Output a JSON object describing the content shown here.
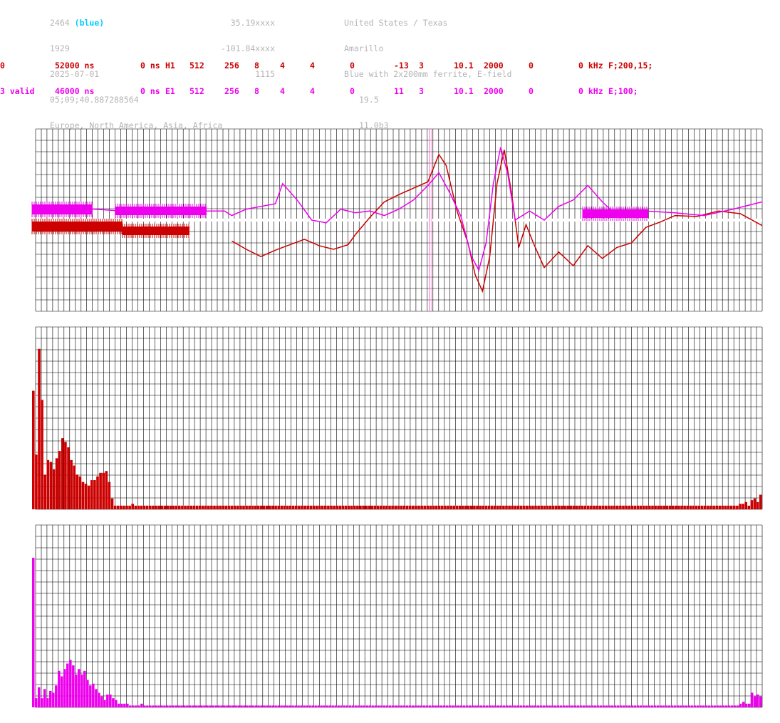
{
  "header": {
    "id": "2464",
    "id_color": "(blue)",
    "number": "1929",
    "date": "2025-07-01",
    "time": "05;09;40.887288564",
    "regions": "Europe, North America, Asia, Africa",
    "lat": "35.19xxxx",
    "lon": "-101.84xxxx",
    "alt": "1115",
    "country": "United States / Texas",
    "city": "Amarillo",
    "antenna": "Blue with 2x200mm ferrite, E-field",
    "val1": "19.5",
    "val2": "11.0b3"
  },
  "channels": [
    {
      "c0": "0",
      "c1": "52000 ns",
      "c2": "0 ns",
      "c3": "H1",
      "c4": "512",
      "c5": "256",
      "c6": "8",
      "c7": "4",
      "c8": "4",
      "c9": "0",
      "c10": "-13",
      "c11": "3",
      "c12": "10.1",
      "c13": "2000",
      "c14": "0",
      "c15": "0 kHz",
      "c16": "F;200,15;"
    },
    {
      "c0": "3 valid",
      "c1": "46000 ns",
      "c2": "0 ns",
      "c3": "E1",
      "c4": "512",
      "c5": "256",
      "c6": "8",
      "c7": "4",
      "c8": "4",
      "c9": "0",
      "c10": "11",
      "c11": "3",
      "c12": "10.1",
      "c13": "2000",
      "c14": "0",
      "c15": "0 kHz",
      "c16": "E;100;"
    }
  ],
  "colors": {
    "red": "#cc0000",
    "magenta": "#ee00ee",
    "grid": "#000000",
    "blue": "#00ccff"
  },
  "chart_data": [
    {
      "type": "line",
      "title": "",
      "xlabel": "",
      "ylabel": "",
      "grid": true,
      "x_range": [
        0,
        1
      ],
      "ylim": [
        -1,
        1
      ],
      "series": [
        {
          "color": "#cc0000",
          "points": [
            [
              0.27,
              -0.23
            ],
            [
              0.29,
              -0.32
            ],
            [
              0.31,
              -0.4
            ],
            [
              0.33,
              -0.33
            ],
            [
              0.35,
              -0.27
            ],
            [
              0.37,
              -0.21
            ],
            [
              0.39,
              -0.28
            ],
            [
              0.41,
              -0.32
            ],
            [
              0.43,
              -0.27
            ],
            [
              0.44,
              -0.16
            ],
            [
              0.46,
              0.03
            ],
            [
              0.48,
              0.2
            ],
            [
              0.5,
              0.28
            ],
            [
              0.52,
              0.35
            ],
            [
              0.54,
              0.42
            ],
            [
              0.555,
              0.72
            ],
            [
              0.565,
              0.6
            ],
            [
              0.58,
              0.1
            ],
            [
              0.595,
              -0.25
            ],
            [
              0.605,
              -0.6
            ],
            [
              0.615,
              -0.78
            ],
            [
              0.625,
              -0.4
            ],
            [
              0.635,
              0.4
            ],
            [
              0.645,
              0.77
            ],
            [
              0.655,
              0.3
            ],
            [
              0.665,
              -0.3
            ],
            [
              0.675,
              -0.05
            ],
            [
              0.685,
              -0.25
            ],
            [
              0.7,
              -0.52
            ],
            [
              0.72,
              -0.35
            ],
            [
              0.74,
              -0.5
            ],
            [
              0.76,
              -0.28
            ],
            [
              0.78,
              -0.42
            ],
            [
              0.8,
              -0.3
            ],
            [
              0.82,
              -0.25
            ],
            [
              0.84,
              -0.08
            ],
            [
              0.86,
              -0.02
            ],
            [
              0.88,
              0.05
            ],
            [
              0.91,
              0.04
            ],
            [
              0.94,
              0.1
            ],
            [
              0.97,
              0.07
            ],
            [
              1.0,
              -0.06
            ]
          ]
        },
        {
          "color": "#ee00ee",
          "points": [
            [
              0.0,
              0.12
            ],
            [
              0.08,
              0.12
            ],
            [
              0.12,
              0.1
            ],
            [
              0.24,
              0.1
            ],
            [
              0.26,
              0.1
            ],
            [
              0.27,
              0.05
            ],
            [
              0.29,
              0.12
            ],
            [
              0.31,
              0.15
            ],
            [
              0.33,
              0.18
            ],
            [
              0.34,
              0.4
            ],
            [
              0.36,
              0.22
            ],
            [
              0.38,
              0.0
            ],
            [
              0.4,
              -0.03
            ],
            [
              0.42,
              0.12
            ],
            [
              0.44,
              0.08
            ],
            [
              0.46,
              0.1
            ],
            [
              0.48,
              0.05
            ],
            [
              0.5,
              0.12
            ],
            [
              0.52,
              0.22
            ],
            [
              0.54,
              0.38
            ],
            [
              0.555,
              0.52
            ],
            [
              0.57,
              0.3
            ],
            [
              0.585,
              0.05
            ],
            [
              0.6,
              -0.4
            ],
            [
              0.61,
              -0.55
            ],
            [
              0.62,
              -0.25
            ],
            [
              0.63,
              0.4
            ],
            [
              0.64,
              0.8
            ],
            [
              0.65,
              0.5
            ],
            [
              0.66,
              0.0
            ],
            [
              0.67,
              0.05
            ],
            [
              0.68,
              0.1
            ],
            [
              0.7,
              0.0
            ],
            [
              0.72,
              0.15
            ],
            [
              0.74,
              0.22
            ],
            [
              0.76,
              0.38
            ],
            [
              0.78,
              0.2
            ],
            [
              0.8,
              0.05
            ],
            [
              0.84,
              0.1
            ],
            [
              0.88,
              0.08
            ],
            [
              0.92,
              0.05
            ],
            [
              0.96,
              0.12
            ],
            [
              1.0,
              0.2
            ]
          ]
        }
      ]
    },
    {
      "type": "bar",
      "title": "",
      "color": "#cc0000",
      "ylim": [
        0,
        1
      ],
      "values": [
        0.65,
        0.3,
        0.88,
        0.6,
        0.19,
        0.27,
        0.26,
        0.22,
        0.28,
        0.32,
        0.39,
        0.37,
        0.34,
        0.27,
        0.24,
        0.19,
        0.18,
        0.15,
        0.14,
        0.13,
        0.16,
        0.16,
        0.18,
        0.2,
        0.2,
        0.21,
        0.15,
        0.06,
        0.02,
        0.02,
        0.02,
        0.02,
        0.02,
        0.02,
        0.03,
        0.02,
        0.02,
        0.02,
        0.02,
        0.02,
        0.02,
        0.02,
        0.02,
        0.02,
        0.02,
        0.02,
        0.02,
        0.02,
        0.02,
        0.02,
        0.02,
        0.02,
        0.02,
        0.02,
        0.02,
        0.02,
        0.02,
        0.02,
        0.02,
        0.02,
        0.02,
        0.02,
        0.02,
        0.02,
        0.02,
        0.02,
        0.02,
        0.02,
        0.02,
        0.02,
        0.02,
        0.02,
        0.02,
        0.02,
        0.02,
        0.02,
        0.02,
        0.02,
        0.02,
        0.02,
        0.02,
        0.02,
        0.02,
        0.02,
        0.02,
        0.02,
        0.02,
        0.02,
        0.02,
        0.02,
        0.02,
        0.02,
        0.02,
        0.02,
        0.02,
        0.02,
        0.02,
        0.02,
        0.02,
        0.02,
        0.02,
        0.02,
        0.02,
        0.02,
        0.02,
        0.02,
        0.02,
        0.02,
        0.02,
        0.02,
        0.02,
        0.02,
        0.02,
        0.02,
        0.02,
        0.02,
        0.02,
        0.02,
        0.02,
        0.02,
        0.02,
        0.02,
        0.02,
        0.02,
        0.02,
        0.02,
        0.02,
        0.02,
        0.02,
        0.02,
        0.02,
        0.02,
        0.02,
        0.02,
        0.02,
        0.02,
        0.02,
        0.02,
        0.02,
        0.02,
        0.02,
        0.02,
        0.02,
        0.02,
        0.02,
        0.02,
        0.02,
        0.02,
        0.02,
        0.02,
        0.02,
        0.02,
        0.02,
        0.02,
        0.02,
        0.02,
        0.02,
        0.02,
        0.02,
        0.02,
        0.02,
        0.02,
        0.02,
        0.02,
        0.02,
        0.02,
        0.02,
        0.02,
        0.02,
        0.02,
        0.02,
        0.02,
        0.02,
        0.02,
        0.02,
        0.02,
        0.02,
        0.02,
        0.02,
        0.02,
        0.02,
        0.02,
        0.02,
        0.02,
        0.02,
        0.02,
        0.02,
        0.02,
        0.02,
        0.02,
        0.02,
        0.02,
        0.02,
        0.02,
        0.02,
        0.02,
        0.02,
        0.02,
        0.02,
        0.02,
        0.02,
        0.02,
        0.02,
        0.02,
        0.02,
        0.02,
        0.02,
        0.02,
        0.02,
        0.02,
        0.02,
        0.02,
        0.02,
        0.02,
        0.02,
        0.02,
        0.02,
        0.02,
        0.02,
        0.02,
        0.02,
        0.02,
        0.02,
        0.02,
        0.02,
        0.02,
        0.02,
        0.02,
        0.02,
        0.02,
        0.02,
        0.02,
        0.02,
        0.02,
        0.02,
        0.02,
        0.02,
        0.02,
        0.02,
        0.02,
        0.02,
        0.02,
        0.03,
        0.03,
        0.04,
        0.02,
        0.05,
        0.06,
        0.04,
        0.08
      ]
    },
    {
      "type": "bar",
      "title": "",
      "color": "#ee00ee",
      "ylim": [
        0,
        1
      ],
      "values": [
        0.82,
        0.05,
        0.11,
        0.05,
        0.1,
        0.05,
        0.09,
        0.08,
        0.12,
        0.2,
        0.17,
        0.21,
        0.24,
        0.26,
        0.23,
        0.18,
        0.21,
        0.18,
        0.2,
        0.15,
        0.12,
        0.13,
        0.1,
        0.08,
        0.06,
        0.04,
        0.07,
        0.07,
        0.05,
        0.04,
        0.02,
        0.02,
        0.02,
        0.02,
        0.01,
        0.01,
        0.01,
        0.01,
        0.02,
        0.01,
        0.01,
        0.01,
        0.01,
        0.01,
        0.01,
        0.01,
        0.01,
        0.01,
        0.01,
        0.01,
        0.01,
        0.01,
        0.01,
        0.01,
        0.01,
        0.01,
        0.01,
        0.01,
        0.01,
        0.01,
        0.01,
        0.01,
        0.01,
        0.01,
        0.01,
        0.01,
        0.01,
        0.01,
        0.01,
        0.01,
        0.01,
        0.01,
        0.01,
        0.01,
        0.01,
        0.01,
        0.01,
        0.01,
        0.01,
        0.01,
        0.01,
        0.01,
        0.01,
        0.01,
        0.01,
        0.01,
        0.01,
        0.01,
        0.01,
        0.01,
        0.01,
        0.01,
        0.01,
        0.01,
        0.01,
        0.01,
        0.01,
        0.01,
        0.01,
        0.01,
        0.01,
        0.01,
        0.01,
        0.01,
        0.01,
        0.01,
        0.01,
        0.01,
        0.01,
        0.01,
        0.01,
        0.01,
        0.01,
        0.01,
        0.01,
        0.01,
        0.01,
        0.01,
        0.01,
        0.01,
        0.01,
        0.01,
        0.01,
        0.01,
        0.01,
        0.01,
        0.01,
        0.01,
        0.01,
        0.01,
        0.01,
        0.01,
        0.01,
        0.01,
        0.01,
        0.01,
        0.01,
        0.01,
        0.01,
        0.01,
        0.01,
        0.01,
        0.01,
        0.01,
        0.01,
        0.01,
        0.01,
        0.01,
        0.01,
        0.01,
        0.01,
        0.01,
        0.01,
        0.01,
        0.01,
        0.01,
        0.01,
        0.01,
        0.01,
        0.01,
        0.01,
        0.01,
        0.01,
        0.01,
        0.01,
        0.01,
        0.01,
        0.01,
        0.01,
        0.01,
        0.01,
        0.01,
        0.01,
        0.01,
        0.01,
        0.01,
        0.01,
        0.01,
        0.01,
        0.01,
        0.01,
        0.01,
        0.01,
        0.01,
        0.01,
        0.01,
        0.01,
        0.01,
        0.01,
        0.01,
        0.01,
        0.01,
        0.01,
        0.01,
        0.01,
        0.01,
        0.01,
        0.01,
        0.01,
        0.01,
        0.01,
        0.01,
        0.01,
        0.01,
        0.01,
        0.01,
        0.01,
        0.01,
        0.01,
        0.01,
        0.01,
        0.01,
        0.01,
        0.01,
        0.01,
        0.01,
        0.01,
        0.01,
        0.01,
        0.01,
        0.01,
        0.01,
        0.01,
        0.01,
        0.01,
        0.01,
        0.01,
        0.01,
        0.01,
        0.01,
        0.01,
        0.01,
        0.01,
        0.01,
        0.01,
        0.01,
        0.01,
        0.01,
        0.01,
        0.01,
        0.01,
        0.01,
        0.01,
        0.01,
        0.01,
        0.01,
        0.01,
        0.01,
        0.02,
        0.03,
        0.02,
        0.02,
        0.08,
        0.06,
        0.07,
        0.06
      ]
    }
  ]
}
